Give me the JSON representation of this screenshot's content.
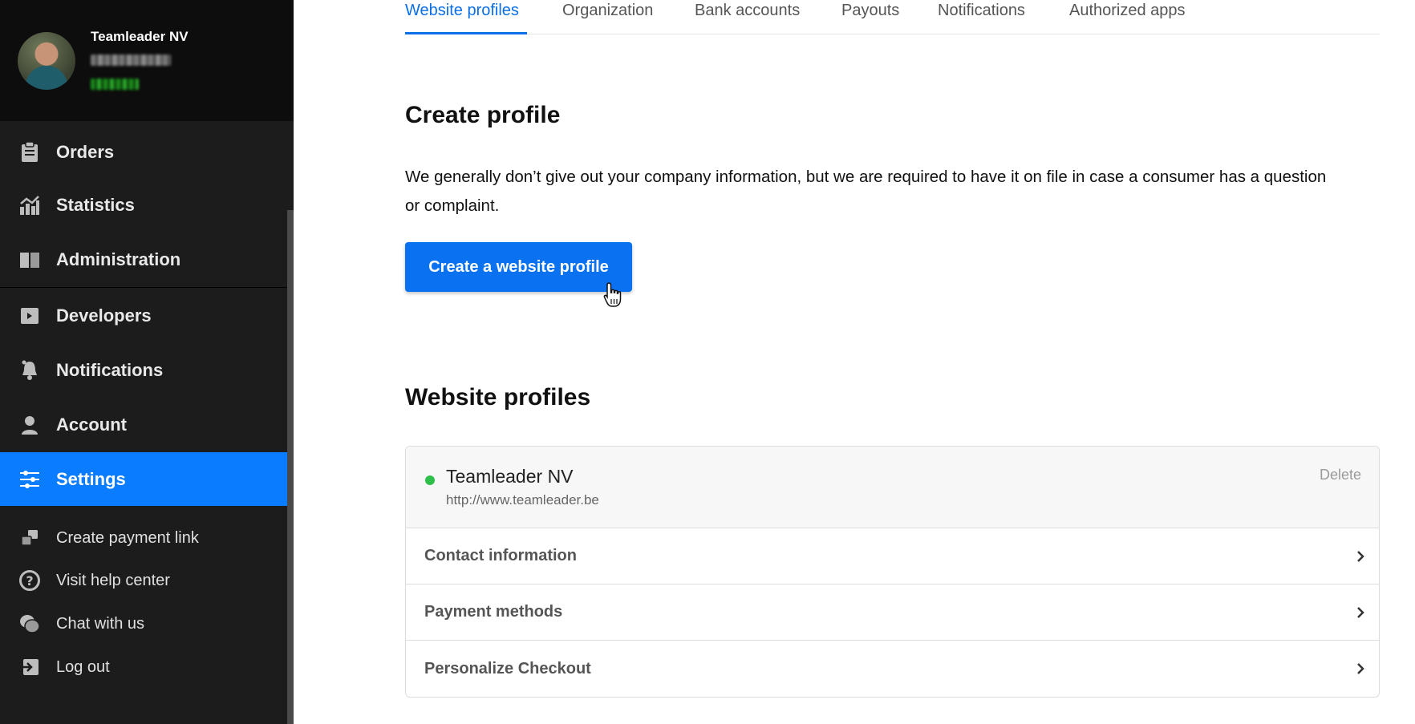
{
  "sidebar": {
    "account_name": "Teamleader NV",
    "items": [
      {
        "label": "Orders",
        "icon": "clipboard-icon"
      },
      {
        "label": "Statistics",
        "icon": "chart-icon"
      },
      {
        "label": "Administration",
        "icon": "book-icon"
      },
      {
        "label": "Developers",
        "icon": "code-icon"
      },
      {
        "label": "Notifications",
        "icon": "bell-icon"
      },
      {
        "label": "Account",
        "icon": "user-icon"
      },
      {
        "label": "Settings",
        "icon": "sliders-icon",
        "active": true
      }
    ],
    "secondary_items": [
      {
        "label": "Create payment link",
        "icon": "link-icon"
      },
      {
        "label": "Visit help center",
        "icon": "help-icon"
      },
      {
        "label": "Chat with us",
        "icon": "chat-icon"
      },
      {
        "label": "Log out",
        "icon": "logout-icon"
      }
    ]
  },
  "tabs": [
    {
      "label": "Website profiles",
      "active": true
    },
    {
      "label": "Organization"
    },
    {
      "label": "Bank accounts"
    },
    {
      "label": "Payouts"
    },
    {
      "label": "Notifications"
    },
    {
      "label": "Authorized apps"
    }
  ],
  "create_section": {
    "title": "Create profile",
    "description": "We generally don’t give out your company information, but we are required to have it on file in case a consumer has a question or complaint.",
    "button_label": "Create a website profile"
  },
  "profiles_section": {
    "title": "Website profiles",
    "profile": {
      "name": "Teamleader NV",
      "url": "http://www.teamleader.be",
      "delete_label": "Delete",
      "status_color": "#2ec04a"
    },
    "rows": [
      {
        "label": "Contact information"
      },
      {
        "label": "Payment methods"
      },
      {
        "label": "Personalize Checkout"
      }
    ]
  },
  "colors": {
    "accent": "#0a72f0",
    "sidebar_bg": "#1c1c1c",
    "active_item": "#0a7cff"
  }
}
